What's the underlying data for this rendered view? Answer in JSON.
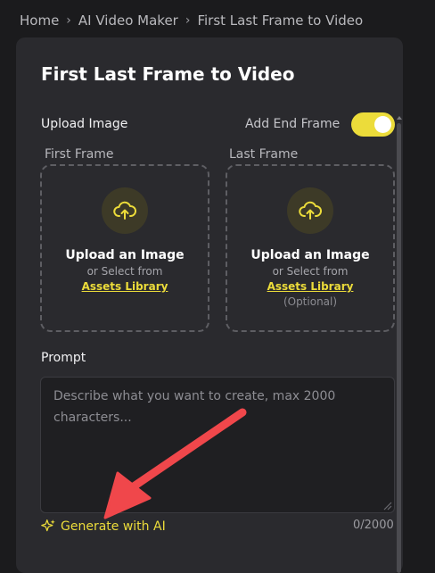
{
  "breadcrumb": {
    "items": [
      "Home",
      "AI Video Maker",
      "First Last Frame to Video"
    ],
    "separator": "›"
  },
  "panel": {
    "title": "First Last Frame to Video",
    "upload_label": "Upload Image",
    "end_frame_toggle": {
      "label": "Add End Frame",
      "checked": true
    }
  },
  "frames": [
    {
      "label": "First Frame",
      "title": "Upload an Image",
      "sub": "or Select from",
      "link": "Assets Library"
    },
    {
      "label": "Last Frame",
      "title": "Upload an Image",
      "sub": "or Select from",
      "link": "Assets Library",
      "optional": "(Optional)"
    }
  ],
  "prompt": {
    "label": "Prompt",
    "placeholder": "Describe what you want to create, max 2000 characters...",
    "generate_label": "Generate with AI",
    "char_count": "0/2000"
  },
  "icons": {
    "upload": "cloud-upload-icon",
    "generate": "sparkle-icon",
    "breadcrumb_separator": "chevron-right-icon",
    "annotation": "red-arrow-icon"
  },
  "colors": {
    "accent": "#ecdc3a",
    "background": "#1b1b1d",
    "panel": "#2a2a2e",
    "annotation_arrow": "#f0474b"
  }
}
